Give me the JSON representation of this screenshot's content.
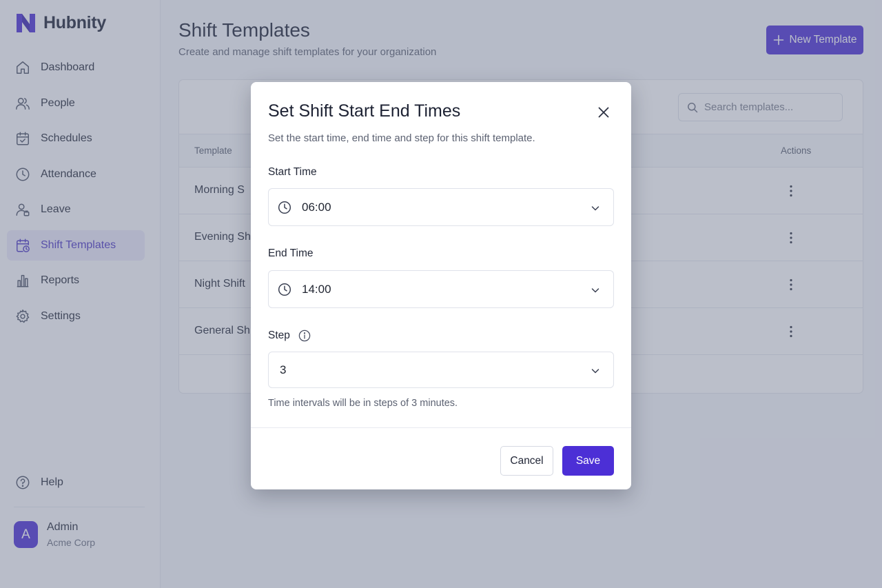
{
  "app": {
    "name": "Hubnity"
  },
  "sidebar": {
    "items": [
      {
        "label": "Dashboard",
        "icon": "home-icon"
      },
      {
        "label": "People",
        "icon": "people-icon"
      },
      {
        "label": "Schedules",
        "icon": "calendar-check-icon"
      },
      {
        "label": "Attendance",
        "icon": "clock-icon"
      },
      {
        "label": "Leave",
        "icon": "user-leave-icon"
      },
      {
        "label": "Shift Templates",
        "icon": "calendar-clock-icon",
        "active": true
      },
      {
        "label": "Reports",
        "icon": "bar-chart-icon"
      },
      {
        "label": "Settings",
        "icon": "gear-icon"
      }
    ],
    "help": {
      "label": "Help",
      "icon": "help-icon"
    },
    "user": {
      "initial": "A",
      "name": "Admin",
      "org": "Acme Corp"
    }
  },
  "header": {
    "title": "Shift Templates",
    "subtitle": "Create and manage shift templates for your organization",
    "new_button": "New Template"
  },
  "table": {
    "search_placeholder": "Search templates...",
    "columns": {
      "template": "Template",
      "actions": "Actions"
    },
    "rows": [
      {
        "name": "Morning S"
      },
      {
        "name": "Evening Sh"
      },
      {
        "name": "Night Shift"
      },
      {
        "name": "General Sh"
      }
    ]
  },
  "modal": {
    "title": "Set Shift Start End Times",
    "description": "Set the start time, end time and step for this shift template.",
    "start_label": "Start Time",
    "start_value": "06:00",
    "end_label": "End Time",
    "end_value": "14:00",
    "step_label": "Step",
    "step_value": "3",
    "hint": "Time intervals will be in steps of 3 minutes.",
    "cancel": "Cancel",
    "save": "Save"
  },
  "colors": {
    "accent": "#4c2fd6",
    "active_bg": "#eceaf9",
    "overlay": "rgba(105,112,138,0.45)"
  }
}
